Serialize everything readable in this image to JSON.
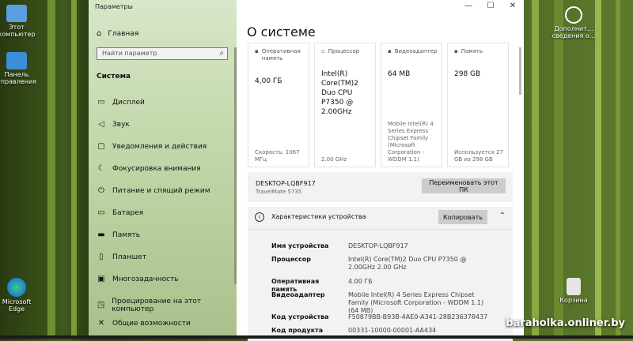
{
  "desktop": {
    "icons": [
      {
        "label": "Этот компьютер"
      },
      {
        "label": "Панель управления"
      },
      {
        "label": "Microsoft Edge"
      },
      {
        "label": "Дополнит... сведения о..."
      },
      {
        "label": "Корзина"
      }
    ],
    "watermark": "baraholka.onliner.by"
  },
  "window": {
    "title": "Параметры",
    "controls": {
      "minimize": "—",
      "maximize": "☐",
      "close": "✕"
    }
  },
  "sidebar": {
    "home": "Главная",
    "search_placeholder": "Найти параметр",
    "section": "Система",
    "items": [
      {
        "label": "Дисплей",
        "icon": "display-icon"
      },
      {
        "label": "Звук",
        "icon": "sound-icon"
      },
      {
        "label": "Уведомления и действия",
        "icon": "notifications-icon"
      },
      {
        "label": "Фокусировка внимания",
        "icon": "focus-icon"
      },
      {
        "label": "Питание и спящий режим",
        "icon": "power-icon"
      },
      {
        "label": "Батарея",
        "icon": "battery-icon"
      },
      {
        "label": "Память",
        "icon": "storage-icon"
      },
      {
        "label": "Планшет",
        "icon": "tablet-icon"
      },
      {
        "label": "Многозадачность",
        "icon": "multitasking-icon"
      },
      {
        "label": "Проецирование на этот компьютер",
        "icon": "projecting-icon"
      },
      {
        "label": "Общие возможности",
        "icon": "shared-icon"
      }
    ]
  },
  "main": {
    "title": "О системе",
    "cards": [
      {
        "header": "Оперативная память",
        "value": "4,00 ГБ",
        "footer": "Скорость: 1067 МГц"
      },
      {
        "header": "Процессор",
        "value": "Intel(R) Core(TM)2 Duo CPU P7350 @ 2.00GHz",
        "footer": "2.00 GHz"
      },
      {
        "header": "Видеоадаптер",
        "value": "64 MB",
        "footer": "Mobile Intel(R) 4 Series Express Chipset Family (Microsoft Corporation - WDDM 1.1)"
      },
      {
        "header": "Память",
        "value": "298 GB",
        "footer": "Используется 27 GB из 298 GB"
      }
    ],
    "pc": {
      "name": "DESKTOP-LQBF917",
      "model": "TravelMate 5735",
      "rename_label": "Переименовать этот ПК"
    },
    "specs": {
      "title": "Характеристики устройства",
      "copy_label": "Копировать",
      "rows": [
        {
          "key": "Имя устройства",
          "value": "DESKTOP-LQBF917"
        },
        {
          "key": "Процессор",
          "value": "Intel(R) Core(TM)2 Duo CPU P7350 @ 2.00GHz 2.00 GHz"
        },
        {
          "key": "Оперативная память",
          "value": "4.00 ГБ"
        },
        {
          "key": "Видеоадаптер",
          "value": "Mobile Intel(R) 4 Series Express Chipset Family (Microsoft Corporation - WDDM 1.1) (64 MB)"
        },
        {
          "key": "Код устройства",
          "value": "F50879BB-B93B-4AE0-A341-28B236378437"
        },
        {
          "key": "Код продукта",
          "value": "00331-10000-00001-AA434"
        }
      ]
    }
  }
}
